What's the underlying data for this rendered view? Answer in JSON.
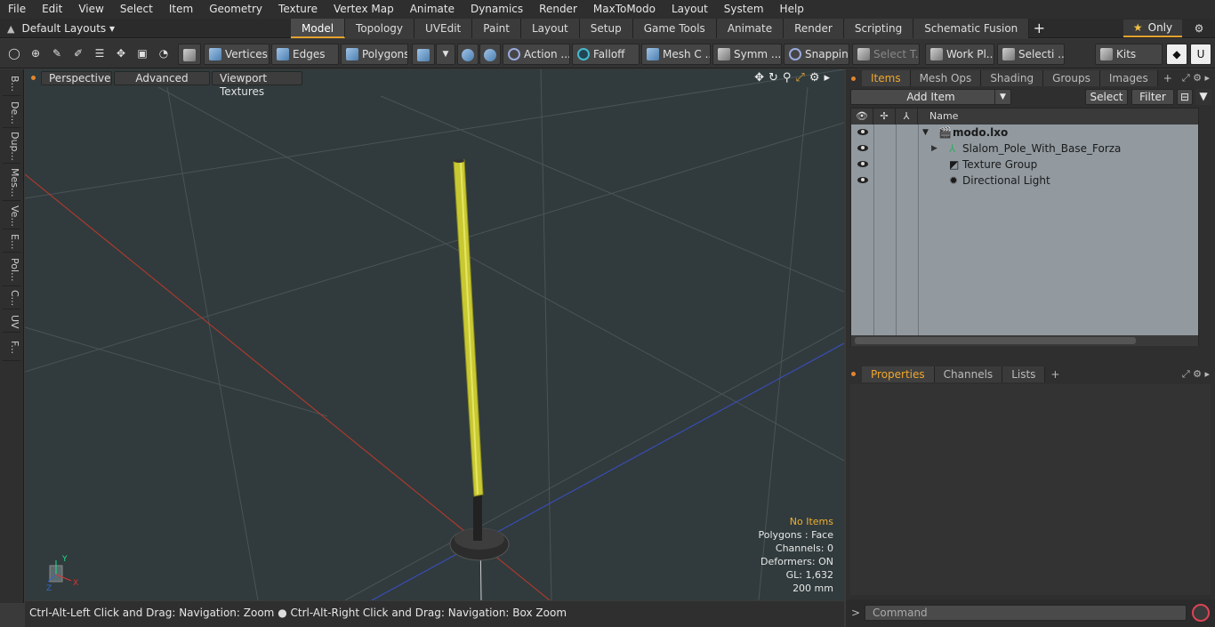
{
  "menu": [
    "File",
    "Edit",
    "View",
    "Select",
    "Item",
    "Geometry",
    "Texture",
    "Vertex Map",
    "Animate",
    "Dynamics",
    "Render",
    "MaxToModo",
    "Layout",
    "System",
    "Help"
  ],
  "layouts": {
    "label": "Default Layouts ▾"
  },
  "tabs": [
    "Model",
    "Topology",
    "UVEdit",
    "Paint",
    "Layout",
    "Setup",
    "Game Tools",
    "Animate",
    "Render",
    "Scripting",
    "Schematic Fusion"
  ],
  "active_tab": "Model",
  "only": {
    "label": "Only"
  },
  "toolbar": {
    "vertices": "Vertices",
    "edges": "Edges",
    "polygons": "Polygons",
    "action": "Action ...",
    "falloff": "Falloff",
    "mesh": "Mesh C ...",
    "symm": "Symm ...",
    "snapping": "Snapping",
    "select_t": "Select T...",
    "workplane": "Work Pl...",
    "selecti": "Selecti ...",
    "kits": "Kits"
  },
  "left_tabs": [
    "B...",
    "De...",
    "Dup...",
    "Mes...",
    "Ve...",
    "E...",
    "Pol...",
    "C...",
    "UV",
    "F..."
  ],
  "viewport": {
    "perspective": "Perspective",
    "advanced": "Advanced",
    "viewport_textures": "Viewport Textures",
    "info": {
      "no_items": "No Items",
      "polygons": "Polygons : Face",
      "channels": "Channels: 0",
      "deformers": "Deformers: ON",
      "gl": "GL: 1,632",
      "size": "200 mm"
    },
    "axis": {
      "y": "Y",
      "x": "X",
      "z": "Z"
    }
  },
  "status": {
    "left": "Ctrl-Alt-Left Click and Drag: Navigation: Zoom",
    "right": "Ctrl-Alt-Right Click and Drag: Navigation: Box Zoom"
  },
  "items_panel": {
    "tabs": [
      "Items",
      "Mesh Ops",
      "Shading",
      "Groups",
      "Images"
    ],
    "add_item": "Add Item",
    "select": "Select",
    "filter": "Filter",
    "name_col": "Name",
    "rows": [
      {
        "label": "modo.lxo"
      },
      {
        "label": "Slalom_Pole_With_Base_Forza"
      },
      {
        "label": "Texture Group"
      },
      {
        "label": "Directional Light"
      }
    ]
  },
  "props_panel": {
    "tabs": [
      "Properties",
      "Channels",
      "Lists"
    ]
  },
  "command": {
    "placeholder": "Command"
  },
  "colors": {
    "accent": "#e3a22d",
    "pole": "#c8c832",
    "viewport_bg": "#313b3d"
  }
}
